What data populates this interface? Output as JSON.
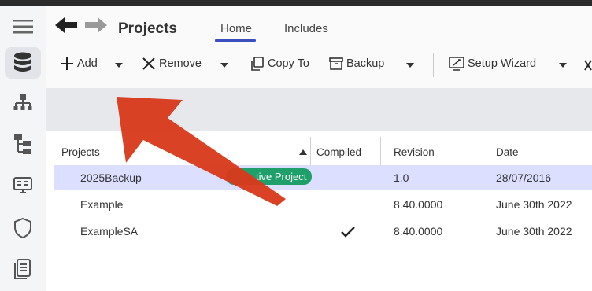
{
  "header": {
    "title": "Projects",
    "tabs": [
      {
        "label": "Home",
        "active": true
      },
      {
        "label": "Includes",
        "active": false
      }
    ]
  },
  "toolbar": {
    "add_label": "Add",
    "remove_label": "Remove",
    "copy_label": "Copy To",
    "backup_label": "Backup",
    "wizard_label": "Setup Wizard"
  },
  "grid": {
    "columns": {
      "projects": "Projects",
      "compiled": "Compiled",
      "revision": "Revision",
      "date": "Date"
    },
    "sort": "ascending",
    "rows": [
      {
        "name": "2025Backup",
        "badge": "tive Project",
        "compiled": false,
        "revision": "1.0",
        "date": "28/07/2016",
        "selected": true
      },
      {
        "name": "Example",
        "badge": "",
        "compiled": false,
        "revision": "8.40.0000",
        "date": "June 30th 2022",
        "selected": false
      },
      {
        "name": "ExampleSA",
        "badge": "",
        "compiled": true,
        "revision": "8.40.0000",
        "date": "June 30th 2022",
        "selected": false
      }
    ]
  },
  "sidebar": {
    "icons": [
      "menu-icon",
      "database-icon",
      "hierarchy-icon",
      "tree-icon",
      "monitor-icon",
      "shield-icon",
      "document-icon"
    ],
    "active": "database-icon"
  },
  "colors": {
    "accent": "#3b4fbf",
    "selected_row": "#dcdfff",
    "badge": "#1fa06a",
    "annotation_arrow": "#d93a1c"
  }
}
